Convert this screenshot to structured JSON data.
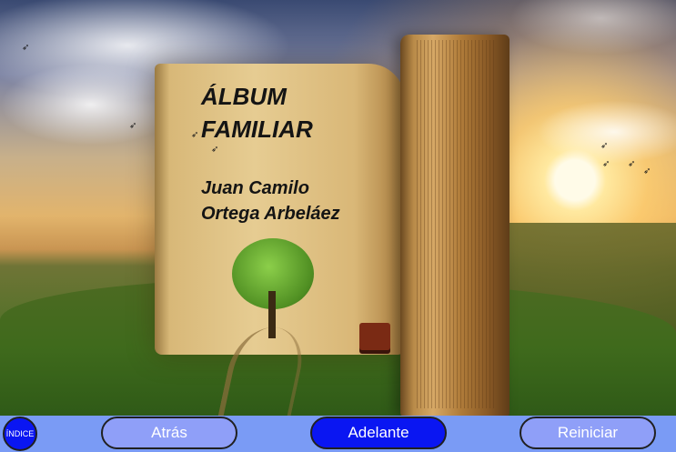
{
  "book": {
    "title": "ÁLBUM\nFAMILIAR",
    "author": "Juan Camilo\nOrtega Arbeláez"
  },
  "nav": {
    "index_label": "ÍNDICE",
    "back_label": "Atrás",
    "forward_label": "Adelante",
    "restart_label": "Reiniciar"
  },
  "colors": {
    "navbar": "#7a9bf5",
    "button_light": "#8f9ff8",
    "button_dark": "#0a16f2",
    "title_text": "#141414"
  }
}
